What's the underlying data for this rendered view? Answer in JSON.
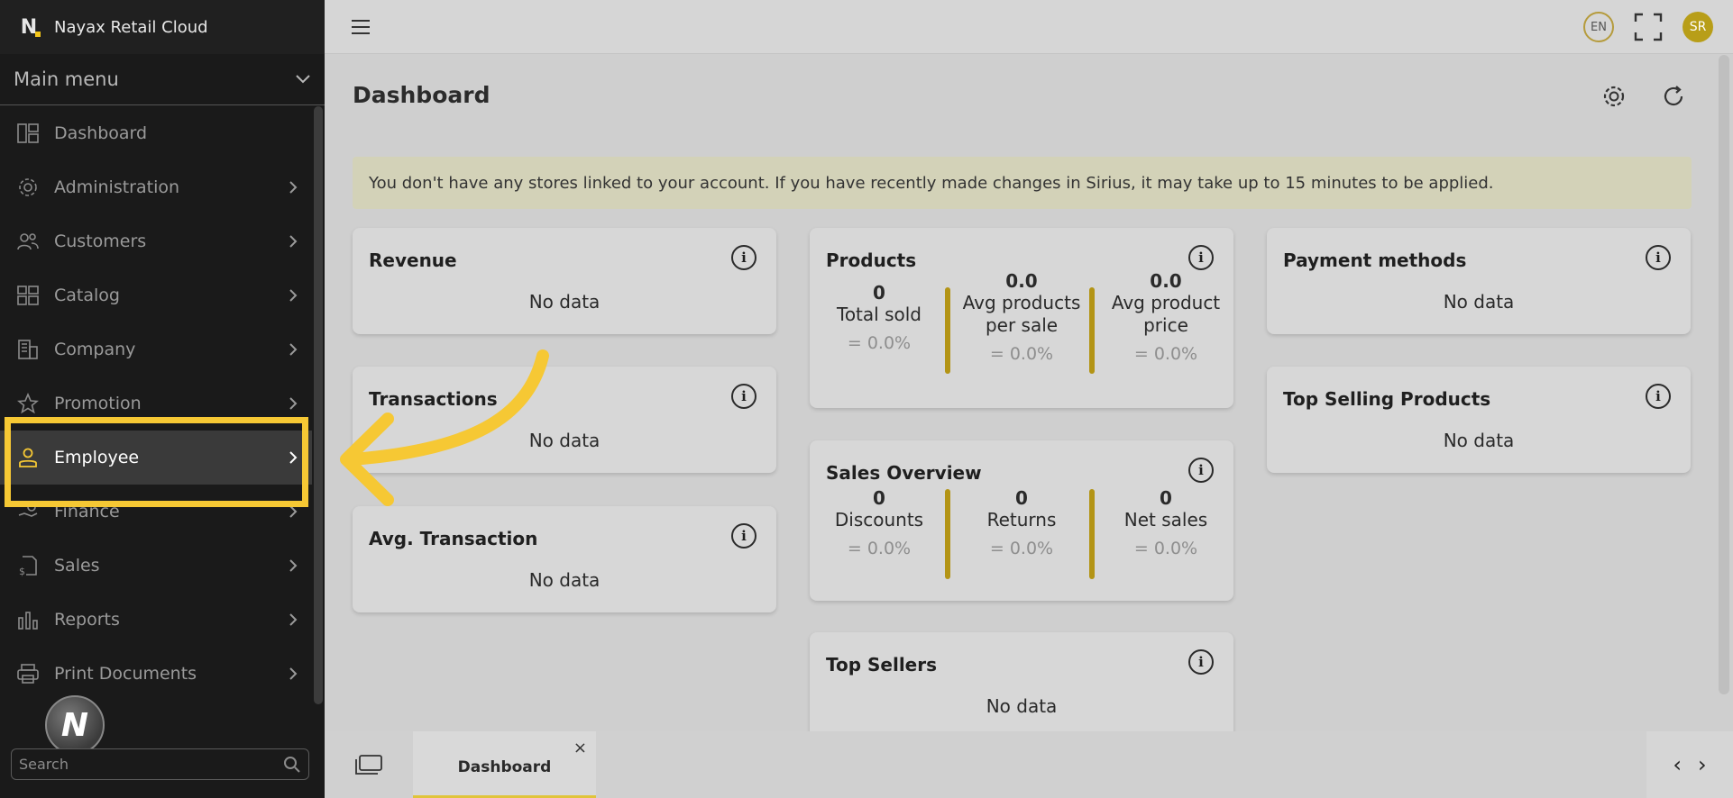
{
  "app": {
    "title": "Nayax Retail Cloud",
    "logo_letter": "N"
  },
  "sidebar": {
    "menu_title": "Main menu",
    "items": [
      {
        "label": "Dashboard",
        "icon": "dashboard-icon",
        "has_children": false
      },
      {
        "label": "Administration",
        "icon": "gear-icon",
        "has_children": true
      },
      {
        "label": "Customers",
        "icon": "users-icon",
        "has_children": true
      },
      {
        "label": "Catalog",
        "icon": "grid-icon",
        "has_children": true
      },
      {
        "label": "Company",
        "icon": "building-icon",
        "has_children": true
      },
      {
        "label": "Promotion",
        "icon": "star-icon",
        "has_children": true
      },
      {
        "label": "Employee",
        "icon": "person-icon",
        "has_children": true,
        "active": true
      },
      {
        "label": "Finance",
        "icon": "hand-coin-icon",
        "has_children": true
      },
      {
        "label": "Sales",
        "icon": "receipt-dollar-icon",
        "has_children": true
      },
      {
        "label": "Reports",
        "icon": "bar-chart-icon",
        "has_children": true
      },
      {
        "label": "Print Documents",
        "icon": "printer-icon",
        "has_children": true
      }
    ],
    "search_placeholder": "Search",
    "avatar_letter": "N"
  },
  "topbar": {
    "language": "EN",
    "user_initials": "SR"
  },
  "page": {
    "title": "Dashboard",
    "alert": "You don't have any stores linked to your account. If you have recently made changes in Sirius, it may take up to 15 minutes to be applied."
  },
  "cards": {
    "revenue": {
      "title": "Revenue",
      "body": "No data"
    },
    "transactions": {
      "title": "Transactions",
      "body": "No data"
    },
    "avg_transaction": {
      "title": "Avg. Transaction",
      "body": "No data"
    },
    "products": {
      "title": "Products",
      "metrics": [
        {
          "value": "0",
          "label": "Total sold",
          "change": "= 0.0%"
        },
        {
          "value": "0.0",
          "label": "Avg products per sale",
          "change": "= 0.0%"
        },
        {
          "value": "0.0",
          "label": "Avg product price",
          "change": "= 0.0%"
        }
      ]
    },
    "sales_overview": {
      "title": "Sales Overview",
      "metrics": [
        {
          "value": "0",
          "label": "Discounts",
          "change": "= 0.0%"
        },
        {
          "value": "0",
          "label": "Returns",
          "change": "= 0.0%"
        },
        {
          "value": "0",
          "label": "Net sales",
          "change": "= 0.0%"
        }
      ]
    },
    "top_sellers": {
      "title": "Top Sellers",
      "body": "No data"
    },
    "payment_methods": {
      "title": "Payment methods",
      "body": "No data"
    },
    "top_selling_products": {
      "title": "Top Selling Products",
      "body": "No data"
    }
  },
  "bottom_tabs": {
    "tabs": [
      {
        "label": "Dashboard",
        "close": "×"
      }
    ],
    "prev": "‹",
    "next": "›"
  },
  "colors": {
    "accent": "#f6c834",
    "separator": "#b39415",
    "sidebar_bg": "#1a1a1a"
  }
}
